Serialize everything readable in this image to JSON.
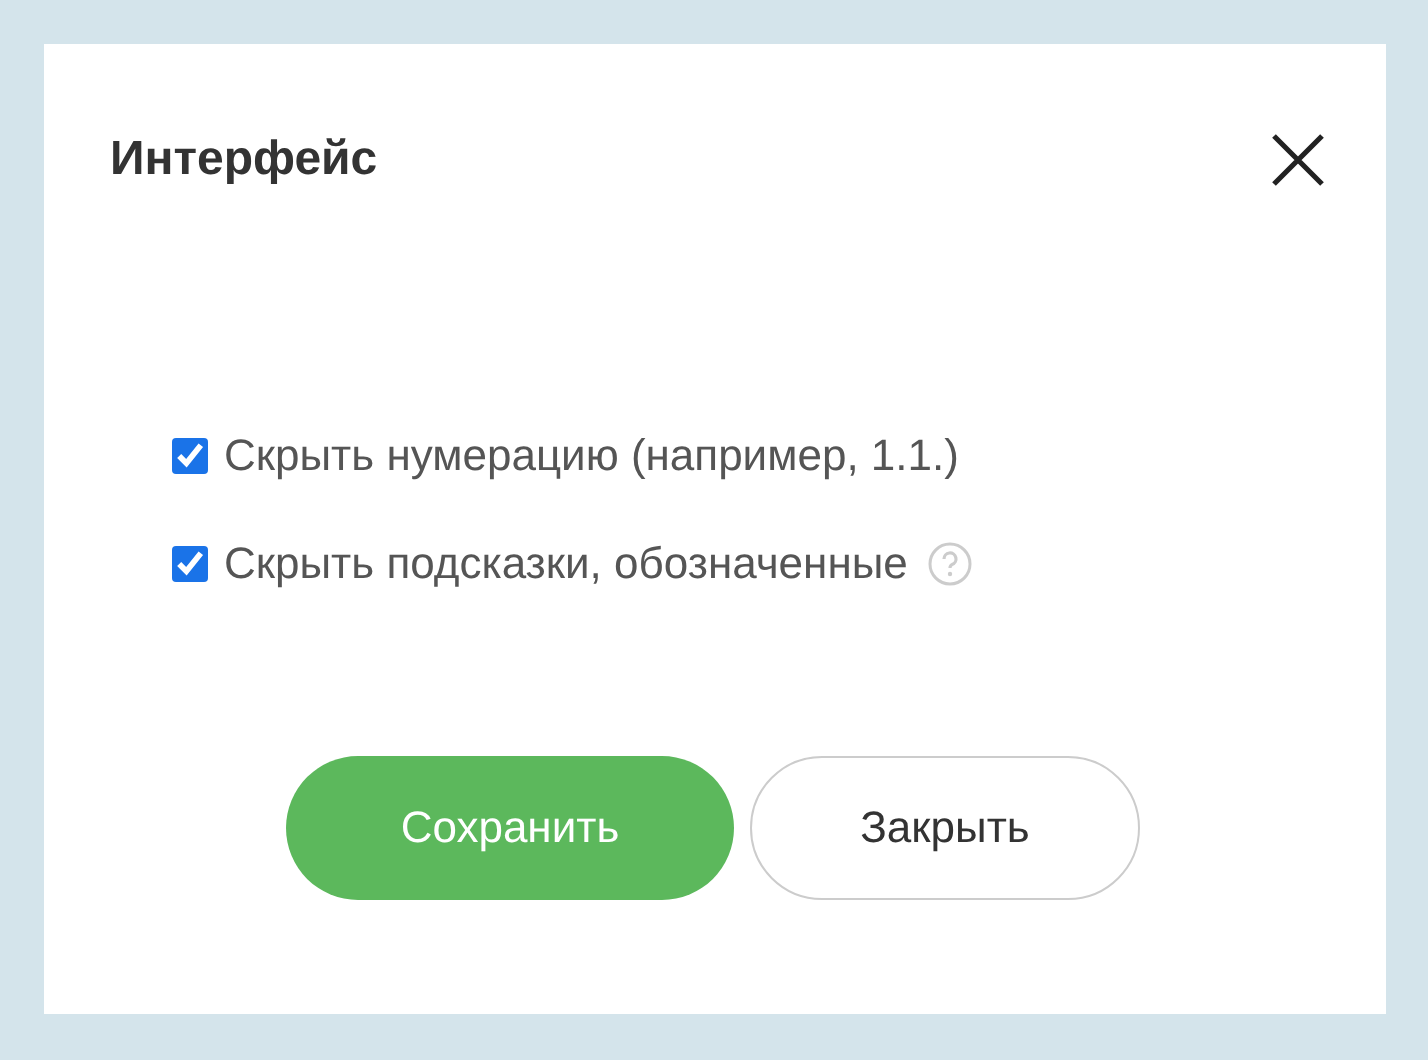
{
  "dialog": {
    "title": "Интерфейс"
  },
  "options": [
    {
      "label": "Скрыть нумерацию (например, 1.1.)",
      "checked": true,
      "help_icon": false
    },
    {
      "label": "Скрыть подсказки, обозначенные",
      "checked": true,
      "help_icon": true
    }
  ],
  "buttons": [
    {
      "label": "Сохранить",
      "kind": "primary"
    },
    {
      "label": "Закрыть",
      "kind": "secondary"
    }
  ]
}
